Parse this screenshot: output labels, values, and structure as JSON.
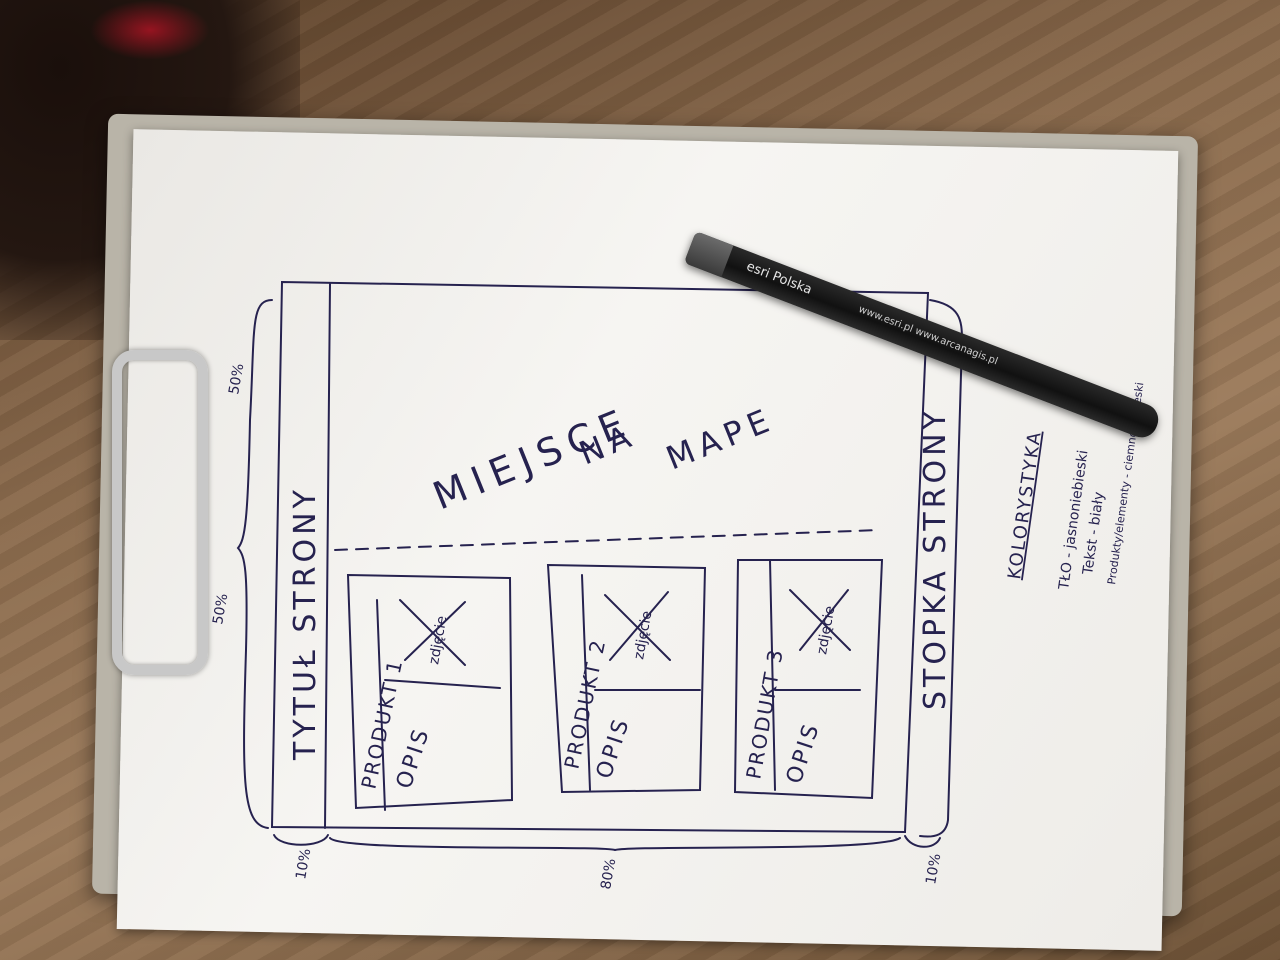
{
  "sketch": {
    "title_label": "TYTUŁ STRONY",
    "map_words": [
      "MIEJSCE",
      "NA",
      "MAPE"
    ],
    "footer_label": "STOPKA STRONY",
    "products": [
      {
        "label": "PRODUKT 1",
        "image": "zdjęcie",
        "desc": "OPIS"
      },
      {
        "label": "PRODUKT 2",
        "image": "zdjęcie",
        "desc": "OPIS"
      },
      {
        "label": "PRODUKT 3",
        "image": "zdjęcie",
        "desc": "OPIS"
      }
    ],
    "pct_50_top": "50%",
    "pct_50_bottom": "50%",
    "pct_left": "10%",
    "pct_middle": "80%",
    "pct_right": "10%",
    "colors": {
      "heading": "KOLORYSTYKA",
      "lines": [
        "TŁO - jasnoniebieski",
        "Tekst - biały",
        "Produkty/elementy - ciemnoniebieski"
      ]
    }
  },
  "pen": {
    "brand": "esri Polska",
    "url": "www.esri.pl   www.arcanagis.pl"
  },
  "palette": {
    "ink": "#26224f",
    "paper": "#f2f1ee",
    "wood": "#8a6a4c"
  }
}
